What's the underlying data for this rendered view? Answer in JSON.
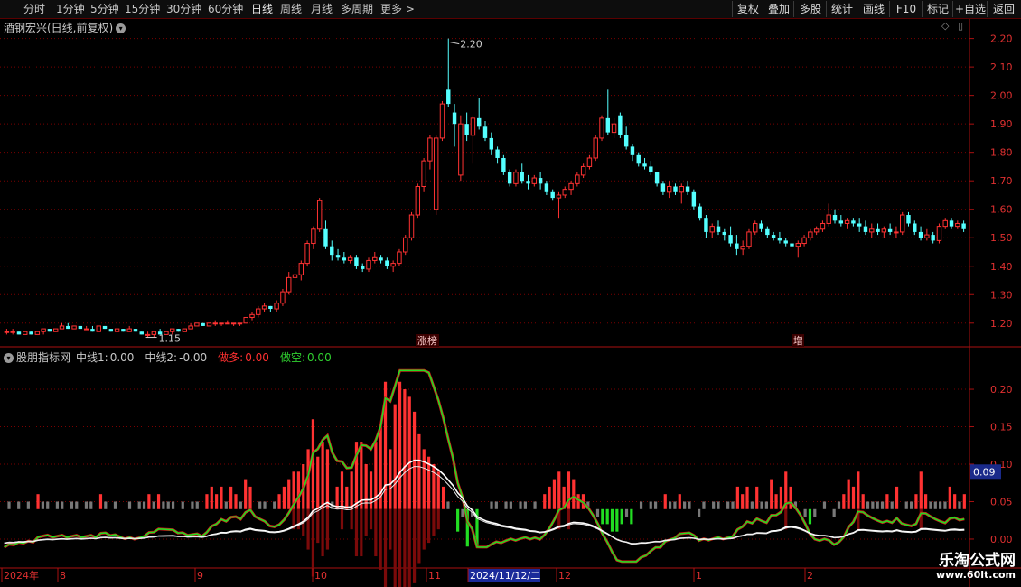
{
  "toolbar": {
    "periods": [
      "分时",
      "1分钟",
      "5分钟",
      "15分钟",
      "30分钟",
      "60分钟",
      "日线",
      "周线",
      "月线",
      "多周期",
      "更多 >"
    ],
    "active_period": "日线",
    "tools": [
      "复权",
      "叠加",
      "多股",
      "统计",
      "画线",
      "F10",
      "标记",
      "+自选",
      "返回"
    ]
  },
  "stock": {
    "name_label": "酒钢宏兴(日线,前复权)",
    "max_price_label": "2.20",
    "min_price_label": "1.15",
    "markers": [
      "涨榜",
      "增"
    ]
  },
  "price_axis": {
    "ticks": [
      "2.20",
      "2.10",
      "2.00",
      "1.90",
      "1.80",
      "1.70",
      "1.60",
      "1.50",
      "1.40",
      "1.30",
      "1.20"
    ]
  },
  "indicator": {
    "name": "股朋指标网",
    "items": [
      {
        "label": "中线1:",
        "value": "0.00",
        "color": "#c8c8c8"
      },
      {
        "label": "中线2:",
        "value": "-0.00",
        "color": "#c8c8c8"
      },
      {
        "label": "做多:",
        "value": "0.00",
        "color": "#ff3030"
      },
      {
        "label": "做空:",
        "value": "0.00",
        "color": "#30d030"
      }
    ],
    "ticks": [
      "0.20",
      "0.15",
      "0.10",
      "0.05",
      "0.00"
    ],
    "current_label": "0.09"
  },
  "date_axis": {
    "labels": [
      "2024年",
      "8",
      "9",
      "10",
      "11",
      "2024/11/12/二",
      "12",
      "1",
      "2"
    ]
  },
  "watermark": {
    "line1": "乐淘公式网",
    "line2": "www.60lt.com"
  },
  "colors": {
    "up": "#ff3232",
    "down": "#54ffff",
    "grid": "#7a0000",
    "axis": "#aa1010",
    "ind_up": "#c81414",
    "ind_down": "#22dd22",
    "ind_neutral": "#787878"
  },
  "chart_data": {
    "type": "candlestick",
    "ylim": [
      1.12,
      2.24
    ],
    "max_price": 2.2,
    "min_price": 1.15,
    "candles": [
      [
        1.17,
        1.18,
        1.16,
        1.17
      ],
      [
        1.17,
        1.18,
        1.16,
        1.17
      ],
      [
        1.17,
        1.17,
        1.16,
        1.16
      ],
      [
        1.16,
        1.17,
        1.16,
        1.17
      ],
      [
        1.17,
        1.17,
        1.16,
        1.16
      ],
      [
        1.16,
        1.17,
        1.16,
        1.17
      ],
      [
        1.17,
        1.18,
        1.16,
        1.18
      ],
      [
        1.18,
        1.18,
        1.17,
        1.17
      ],
      [
        1.17,
        1.18,
        1.17,
        1.18
      ],
      [
        1.18,
        1.2,
        1.18,
        1.19
      ],
      [
        1.19,
        1.2,
        1.18,
        1.18
      ],
      [
        1.18,
        1.19,
        1.18,
        1.19
      ],
      [
        1.19,
        1.19,
        1.18,
        1.18
      ],
      [
        1.18,
        1.19,
        1.18,
        1.18
      ],
      [
        1.18,
        1.19,
        1.17,
        1.17
      ],
      [
        1.17,
        1.19,
        1.17,
        1.19
      ],
      [
        1.19,
        1.19,
        1.18,
        1.18
      ],
      [
        1.18,
        1.18,
        1.17,
        1.17
      ],
      [
        1.17,
        1.18,
        1.17,
        1.18
      ],
      [
        1.18,
        1.18,
        1.17,
        1.17
      ],
      [
        1.17,
        1.19,
        1.17,
        1.18
      ],
      [
        1.18,
        1.18,
        1.17,
        1.17
      ],
      [
        1.17,
        1.17,
        1.16,
        1.16
      ],
      [
        1.16,
        1.17,
        1.15,
        1.16
      ],
      [
        1.16,
        1.17,
        1.15,
        1.17
      ],
      [
        1.17,
        1.18,
        1.16,
        1.16
      ],
      [
        1.16,
        1.17,
        1.16,
        1.17
      ],
      [
        1.17,
        1.18,
        1.16,
        1.18
      ],
      [
        1.18,
        1.18,
        1.17,
        1.17
      ],
      [
        1.17,
        1.18,
        1.17,
        1.18
      ],
      [
        1.18,
        1.2,
        1.18,
        1.19
      ],
      [
        1.19,
        1.2,
        1.19,
        1.2
      ],
      [
        1.2,
        1.2,
        1.19,
        1.19
      ],
      [
        1.19,
        1.2,
        1.19,
        1.2
      ],
      [
        1.2,
        1.21,
        1.19,
        1.2
      ],
      [
        1.2,
        1.2,
        1.19,
        1.2
      ],
      [
        1.2,
        1.21,
        1.2,
        1.2
      ],
      [
        1.2,
        1.2,
        1.19,
        1.2
      ],
      [
        1.2,
        1.2,
        1.19,
        1.2
      ],
      [
        1.2,
        1.22,
        1.2,
        1.22
      ],
      [
        1.22,
        1.24,
        1.21,
        1.23
      ],
      [
        1.23,
        1.26,
        1.22,
        1.25
      ],
      [
        1.25,
        1.27,
        1.24,
        1.26
      ],
      [
        1.26,
        1.26,
        1.24,
        1.25
      ],
      [
        1.25,
        1.28,
        1.24,
        1.27
      ],
      [
        1.27,
        1.32,
        1.26,
        1.31
      ],
      [
        1.31,
        1.38,
        1.3,
        1.36
      ],
      [
        1.36,
        1.4,
        1.33,
        1.37
      ],
      [
        1.37,
        1.42,
        1.35,
        1.41
      ],
      [
        1.41,
        1.49,
        1.4,
        1.48
      ],
      [
        1.48,
        1.54,
        1.46,
        1.53
      ],
      [
        1.53,
        1.64,
        1.52,
        1.63
      ],
      [
        1.53,
        1.56,
        1.46,
        1.47
      ],
      [
        1.47,
        1.49,
        1.42,
        1.44
      ],
      [
        1.44,
        1.46,
        1.42,
        1.43
      ],
      [
        1.43,
        1.45,
        1.41,
        1.42
      ],
      [
        1.42,
        1.44,
        1.41,
        1.43
      ],
      [
        1.43,
        1.44,
        1.39,
        1.4
      ],
      [
        1.4,
        1.41,
        1.38,
        1.39
      ],
      [
        1.39,
        1.43,
        1.38,
        1.42
      ],
      [
        1.42,
        1.45,
        1.41,
        1.43
      ],
      [
        1.43,
        1.44,
        1.41,
        1.42
      ],
      [
        1.42,
        1.43,
        1.39,
        1.4
      ],
      [
        1.4,
        1.42,
        1.38,
        1.41
      ],
      [
        1.41,
        1.46,
        1.4,
        1.45
      ],
      [
        1.45,
        1.51,
        1.44,
        1.5
      ],
      [
        1.5,
        1.59,
        1.49,
        1.58
      ],
      [
        1.58,
        1.69,
        1.57,
        1.68
      ],
      [
        1.68,
        1.78,
        1.66,
        1.77
      ],
      [
        1.77,
        1.86,
        1.74,
        1.85
      ],
      [
        1.6,
        1.86,
        1.58,
        1.85
      ],
      [
        1.85,
        1.98,
        1.84,
        1.97
      ],
      [
        2.02,
        2.2,
        1.96,
        1.97
      ],
      [
        1.94,
        1.97,
        1.82,
        1.9
      ],
      [
        1.72,
        1.93,
        1.7,
        1.9
      ],
      [
        1.9,
        1.94,
        1.84,
        1.86
      ],
      [
        1.86,
        1.93,
        1.76,
        1.92
      ],
      [
        1.92,
        1.99,
        1.88,
        1.89
      ],
      [
        1.89,
        1.91,
        1.84,
        1.85
      ],
      [
        1.85,
        1.87,
        1.79,
        1.81
      ],
      [
        1.81,
        1.82,
        1.76,
        1.78
      ],
      [
        1.78,
        1.79,
        1.72,
        1.73
      ],
      [
        1.73,
        1.74,
        1.68,
        1.69
      ],
      [
        1.69,
        1.74,
        1.68,
        1.73
      ],
      [
        1.73,
        1.76,
        1.69,
        1.7
      ],
      [
        1.7,
        1.72,
        1.67,
        1.69
      ],
      [
        1.69,
        1.72,
        1.68,
        1.71
      ],
      [
        1.71,
        1.73,
        1.67,
        1.69
      ],
      [
        1.69,
        1.7,
        1.65,
        1.66
      ],
      [
        1.66,
        1.67,
        1.63,
        1.64
      ],
      [
        1.64,
        1.66,
        1.57,
        1.65
      ],
      [
        1.65,
        1.68,
        1.64,
        1.67
      ],
      [
        1.67,
        1.7,
        1.65,
        1.69
      ],
      [
        1.69,
        1.73,
        1.68,
        1.72
      ],
      [
        1.72,
        1.76,
        1.71,
        1.75
      ],
      [
        1.75,
        1.79,
        1.74,
        1.78
      ],
      [
        1.78,
        1.86,
        1.77,
        1.85
      ],
      [
        1.85,
        1.93,
        1.84,
        1.92
      ],
      [
        1.92,
        2.02,
        1.86,
        1.87
      ],
      [
        1.87,
        1.92,
        1.85,
        1.9
      ],
      [
        1.93,
        1.94,
        1.85,
        1.86
      ],
      [
        1.86,
        1.89,
        1.81,
        1.82
      ],
      [
        1.82,
        1.83,
        1.77,
        1.79
      ],
      [
        1.79,
        1.8,
        1.75,
        1.76
      ],
      [
        1.76,
        1.78,
        1.74,
        1.75
      ],
      [
        1.75,
        1.77,
        1.72,
        1.73
      ],
      [
        1.73,
        1.73,
        1.68,
        1.69
      ],
      [
        1.69,
        1.7,
        1.65,
        1.66
      ],
      [
        1.66,
        1.7,
        1.64,
        1.68
      ],
      [
        1.68,
        1.69,
        1.65,
        1.66
      ],
      [
        1.66,
        1.69,
        1.62,
        1.68
      ],
      [
        1.68,
        1.7,
        1.65,
        1.66
      ],
      [
        1.66,
        1.67,
        1.6,
        1.61
      ],
      [
        1.61,
        1.62,
        1.56,
        1.57
      ],
      [
        1.57,
        1.58,
        1.5,
        1.52
      ],
      [
        1.52,
        1.55,
        1.5,
        1.54
      ],
      [
        1.54,
        1.56,
        1.51,
        1.52
      ],
      [
        1.52,
        1.53,
        1.49,
        1.51
      ],
      [
        1.51,
        1.54,
        1.47,
        1.48
      ],
      [
        1.48,
        1.51,
        1.44,
        1.46
      ],
      [
        1.46,
        1.49,
        1.44,
        1.47
      ],
      [
        1.47,
        1.53,
        1.46,
        1.52
      ],
      [
        1.52,
        1.56,
        1.51,
        1.55
      ],
      [
        1.55,
        1.56,
        1.52,
        1.53
      ],
      [
        1.53,
        1.54,
        1.5,
        1.51
      ],
      [
        1.51,
        1.52,
        1.49,
        1.5
      ],
      [
        1.5,
        1.52,
        1.48,
        1.49
      ],
      [
        1.49,
        1.5,
        1.47,
        1.48
      ],
      [
        1.48,
        1.49,
        1.46,
        1.47
      ],
      [
        1.47,
        1.49,
        1.43,
        1.48
      ],
      [
        1.48,
        1.51,
        1.47,
        1.5
      ],
      [
        1.5,
        1.53,
        1.49,
        1.52
      ],
      [
        1.52,
        1.54,
        1.51,
        1.53
      ],
      [
        1.53,
        1.56,
        1.52,
        1.55
      ],
      [
        1.55,
        1.62,
        1.54,
        1.58
      ],
      [
        1.58,
        1.6,
        1.55,
        1.56
      ],
      [
        1.56,
        1.58,
        1.54,
        1.55
      ],
      [
        1.55,
        1.57,
        1.53,
        1.56
      ],
      [
        1.56,
        1.57,
        1.54,
        1.55
      ],
      [
        1.55,
        1.57,
        1.52,
        1.54
      ],
      [
        1.54,
        1.56,
        1.51,
        1.52
      ],
      [
        1.52,
        1.55,
        1.5,
        1.53
      ],
      [
        1.53,
        1.55,
        1.51,
        1.52
      ],
      [
        1.52,
        1.54,
        1.5,
        1.53
      ],
      [
        1.53,
        1.55,
        1.51,
        1.52
      ],
      [
        1.52,
        1.54,
        1.5,
        1.52
      ],
      [
        1.52,
        1.59,
        1.51,
        1.58
      ],
      [
        1.58,
        1.59,
        1.54,
        1.55
      ],
      [
        1.55,
        1.56,
        1.51,
        1.52
      ],
      [
        1.52,
        1.54,
        1.49,
        1.5
      ],
      [
        1.5,
        1.53,
        1.49,
        1.51
      ],
      [
        1.51,
        1.52,
        1.48,
        1.49
      ],
      [
        1.49,
        1.55,
        1.48,
        1.54
      ],
      [
        1.54,
        1.57,
        1.53,
        1.56
      ],
      [
        1.56,
        1.57,
        1.53,
        1.54
      ],
      [
        1.54,
        1.56,
        1.53,
        1.55
      ],
      [
        1.55,
        1.56,
        1.52,
        1.53
      ]
    ],
    "indicator": {
      "ylim": [
        -0.035,
        0.235
      ],
      "bars_top": [
        0.04,
        0.05,
        0.04,
        0.05,
        0.04,
        0.05,
        0.04,
        0.06,
        0.05,
        0.05,
        0.04,
        0.05,
        0.05,
        0.04,
        0.05,
        0.05,
        0.04,
        0.05,
        0.05,
        0.04,
        0.06,
        0.05,
        0.04,
        0.05,
        0.04,
        0.04,
        0.05,
        0.04,
        0.05,
        0.05,
        0.06,
        0.05,
        0.06,
        0.05,
        0.05,
        0.05,
        0.04,
        0.05,
        0.04,
        0.05,
        0.05,
        0.04,
        0.06,
        0.07,
        0.06,
        0.07,
        0.05,
        0.07,
        0.06,
        0.05,
        0.08,
        0.07,
        0.04,
        0.05,
        0.05,
        0.04,
        0.05,
        0.06,
        0.07,
        0.08,
        0.09,
        0.09,
        0.1,
        0.12,
        0.16,
        0.11,
        0.13,
        0.12,
        0.05,
        0.07,
        0.09,
        0.07,
        0.09,
        0.13,
        0.13,
        0.1,
        0.09,
        0.13,
        0.15,
        0.21,
        0.12,
        0.18,
        0.21,
        0.2,
        0.19,
        0.17,
        0.14,
        0.12,
        0.11,
        0.1,
        0.09,
        0.07,
        0.05,
        0.04,
        0.01,
        0.03,
        -0.01,
        0.03,
        -0.01,
        0.04,
        0.04,
        0.05,
        0.05,
        0.04,
        0.05,
        0.05,
        0.04,
        0.05,
        0.05,
        0.04,
        0.05,
        0.04,
        0.06,
        0.07,
        0.08,
        0.09,
        0.07,
        0.09,
        0.08,
        0.06,
        0.06,
        0.05,
        0.04,
        0.03,
        0.02,
        0.02,
        0.01,
        0.01,
        0.02,
        0.03,
        0.02,
        0.04,
        0.05,
        0.04,
        0.05,
        0.05,
        0.04,
        0.06,
        0.05,
        0.05,
        0.06,
        0.05,
        0.05,
        0.04,
        0.03,
        0.05,
        0.04,
        0.05,
        0.05,
        0.04,
        0.05,
        0.05,
        0.07,
        0.06,
        0.07,
        0.05,
        0.07,
        0.05,
        0.05,
        0.08,
        0.06,
        0.07,
        0.09,
        0.07,
        0.05,
        0.04,
        0.03,
        0.02,
        0.03,
        0.04,
        0.05,
        0.04,
        0.03,
        0.05,
        0.06,
        0.08,
        0.07,
        0.09,
        0.06,
        0.05,
        0.05,
        0.05,
        0.05,
        0.06,
        0.05,
        0.07,
        0.04,
        0.05,
        0.05,
        0.06,
        0.09,
        0.06,
        0.05,
        0.05,
        0.05,
        0.05,
        0.07,
        0.06,
        0.05,
        0.06
      ]
    }
  }
}
